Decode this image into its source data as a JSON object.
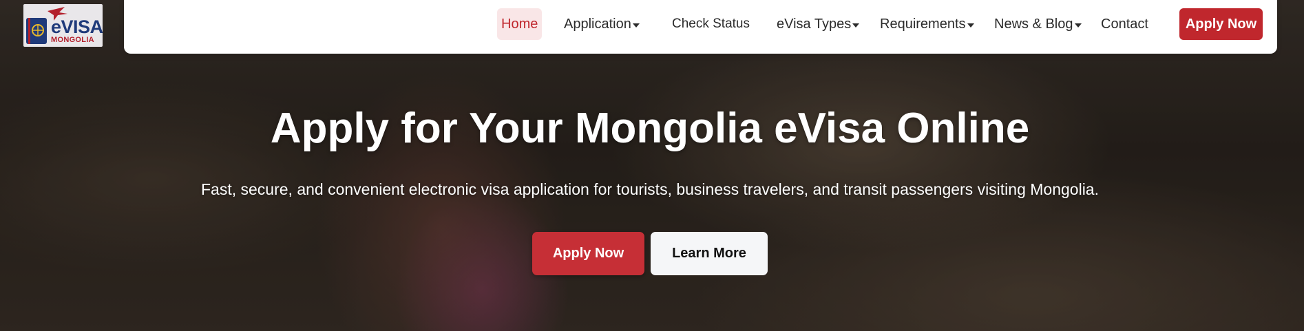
{
  "logo": {
    "main_text": "eVISA",
    "sub_text": "MONGOLIA"
  },
  "nav": {
    "items": [
      {
        "label": "Home",
        "active": true,
        "dropdown": false
      },
      {
        "label": "Application",
        "active": false,
        "dropdown": true
      },
      {
        "label": "Check Status",
        "active": false,
        "dropdown": false
      },
      {
        "label": "eVisa Types",
        "active": false,
        "dropdown": true
      },
      {
        "label": "Requirements",
        "active": false,
        "dropdown": true
      },
      {
        "label": "News & Blog",
        "active": false,
        "dropdown": true
      },
      {
        "label": "Contact",
        "active": false,
        "dropdown": false
      }
    ],
    "apply_label": "Apply Now"
  },
  "hero": {
    "title": "Apply for Your Mongolia eVisa Online",
    "subtitle": "Fast, secure, and convenient electronic visa application for tourists, business travelers, and transit passengers visiting Mongolia.",
    "primary_button": "Apply Now",
    "secondary_button": "Learn More"
  },
  "colors": {
    "brand_red": "#c0272d",
    "brand_blue": "#1f3a7a",
    "active_bg": "#f9e6e7"
  },
  "icons": {
    "logo": "passport-plane-logo-icon",
    "dropdown": "caret-down-icon"
  }
}
